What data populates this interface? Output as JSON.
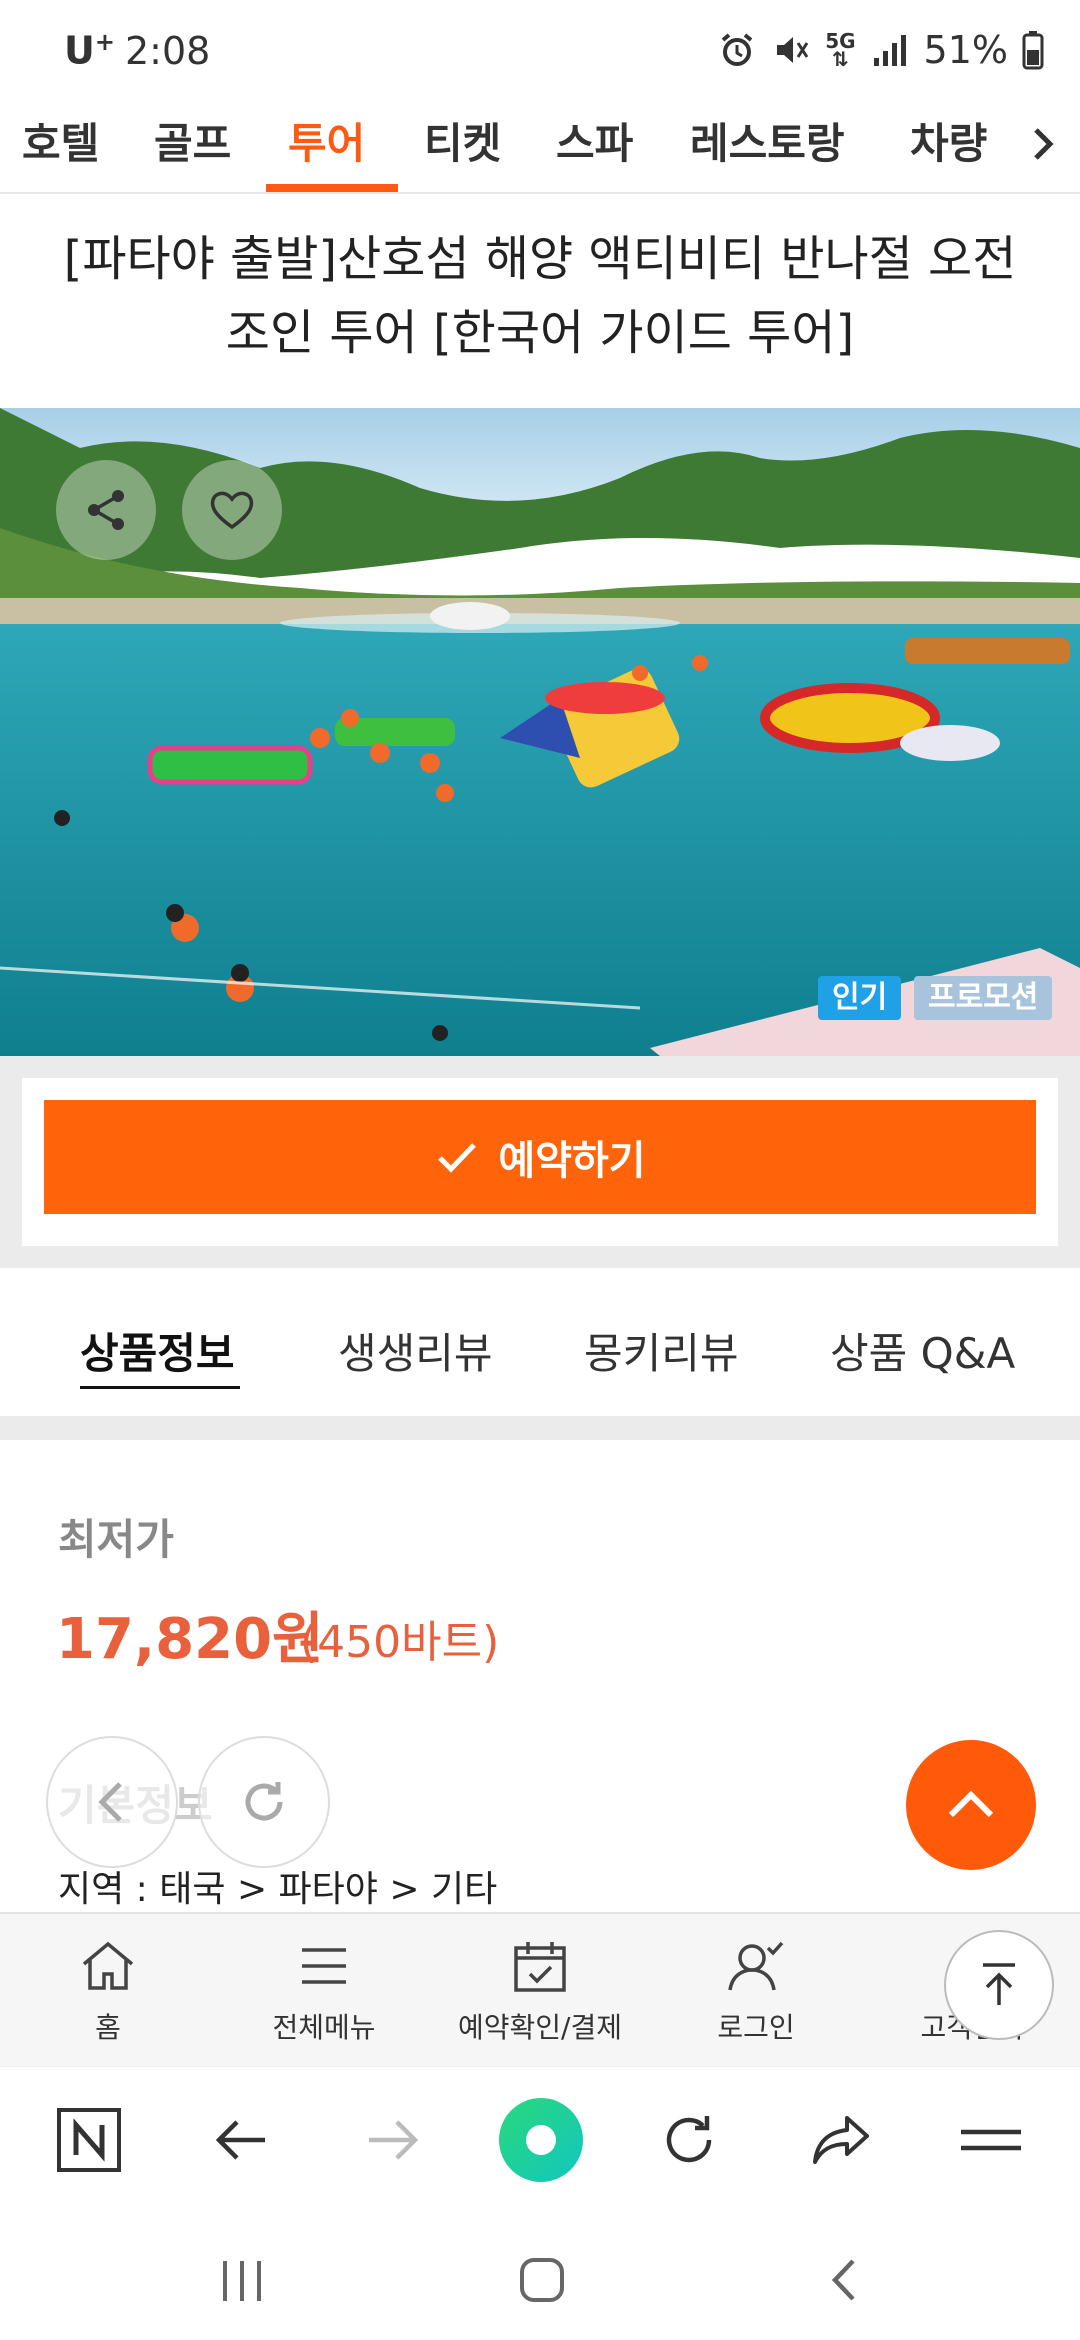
{
  "status_bar": {
    "carrier": "U",
    "carrier_plus": "+",
    "time": "2:08",
    "network": "5G",
    "battery": "51%"
  },
  "category_tabs": [
    {
      "label": "호텔",
      "active": false
    },
    {
      "label": "골프",
      "active": false
    },
    {
      "label": "투어",
      "active": true
    },
    {
      "label": "티켓",
      "active": false
    },
    {
      "label": "스파",
      "active": false
    },
    {
      "label": "레스토랑",
      "active": false
    },
    {
      "label": "차량",
      "active": false
    }
  ],
  "product": {
    "title_line1": "[파타야 출발]산호섬 해양 액티비티 반나절 오전",
    "title_line2": "조인 투어 [한국어 가이드 투어]",
    "badges": [
      "인기",
      "프로모션"
    ]
  },
  "booking": {
    "button_label": "예약하기"
  },
  "product_tabs": [
    {
      "label": "상품정보",
      "active": true
    },
    {
      "label": "생생리뷰",
      "active": false
    },
    {
      "label": "몽키리뷰",
      "active": false
    },
    {
      "label": "상품 Q&A",
      "active": false
    }
  ],
  "price": {
    "label": "최저가",
    "krw": "17,820원",
    "thb": "(450바트)"
  },
  "basic_info": {
    "heading": "기본정보",
    "region": "지역 : 태국 > 파타야 > 기타"
  },
  "site_nav": [
    {
      "label": "홈",
      "icon": "home-icon"
    },
    {
      "label": "전체메뉴",
      "icon": "menu-icon"
    },
    {
      "label": "예약확인/결제",
      "icon": "calendar-check-icon"
    },
    {
      "label": "로그인",
      "icon": "user-icon"
    },
    {
      "label": "고객센터",
      "icon": "headset-icon"
    }
  ],
  "browser_bar": {
    "icons": [
      "naver-n-icon",
      "back-arrow-icon",
      "forward-arrow-icon",
      "green-dot-icon",
      "reload-icon",
      "share-icon",
      "hamburger-icon"
    ]
  },
  "colors": {
    "accent": "#ff5a14",
    "button": "#ff640a",
    "price": "#e8603c",
    "badge_popular": "#1ea1e6",
    "badge_promo": "#a8c4dc"
  }
}
